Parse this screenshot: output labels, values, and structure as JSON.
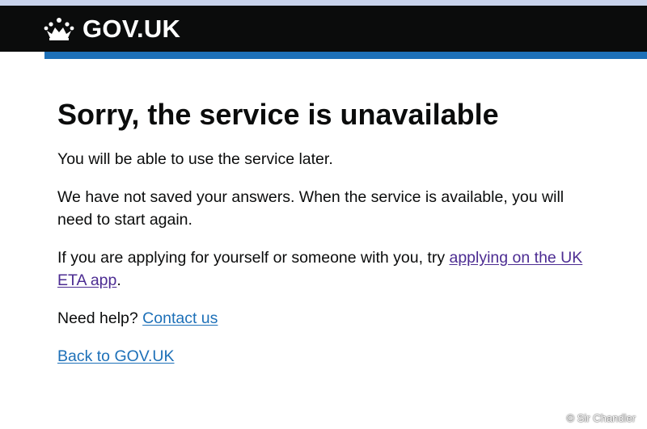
{
  "header": {
    "logo_text": "GOV.UK",
    "logo_icon": "crown-icon"
  },
  "main": {
    "title": "Sorry, the service is unavailable",
    "para1": "You will be able to use the service later.",
    "para2": "We have not saved your answers. When the service is available, you will need to start again.",
    "para3_prefix": "If you are applying for yourself or someone with you, try ",
    "para3_link": "applying on the UK ETA app",
    "para3_suffix": ".",
    "help_prefix": "Need help? ",
    "help_link": "Contact us",
    "back_link": "Back to GOV.UK"
  },
  "watermark": "© Sir Chandler",
  "colors": {
    "header_bg": "#0b0c0c",
    "header_accent": "#1d70b8",
    "link": "#1d70b8",
    "visited_link": "#4c2c92",
    "text": "#0b0c0c"
  }
}
